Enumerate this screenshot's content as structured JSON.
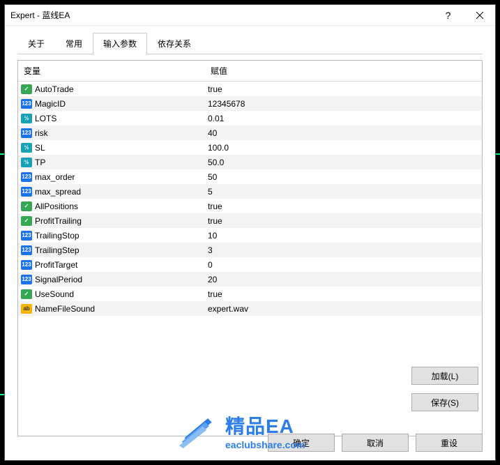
{
  "window": {
    "title": "Expert - 蓝线EA",
    "help": "?"
  },
  "tabs": {
    "about": "关于",
    "common": "常用",
    "inputs": "输入参数",
    "deps": "依存关系"
  },
  "columns": {
    "variable": "变量",
    "value": "赋值"
  },
  "params": [
    {
      "type": "bool",
      "name": "AutoTrade",
      "value": "true"
    },
    {
      "type": "int",
      "name": "MagicID",
      "value": "12345678"
    },
    {
      "type": "dbl",
      "name": "LOTS",
      "value": "0.01"
    },
    {
      "type": "int",
      "name": "risk",
      "value": "40"
    },
    {
      "type": "dbl",
      "name": "SL",
      "value": "100.0"
    },
    {
      "type": "dbl",
      "name": "TP",
      "value": "50.0"
    },
    {
      "type": "int",
      "name": "max_order",
      "value": "50"
    },
    {
      "type": "int",
      "name": "max_spread",
      "value": "5"
    },
    {
      "type": "bool",
      "name": "AllPositions",
      "value": "true"
    },
    {
      "type": "bool",
      "name": "ProfitTrailing",
      "value": "true"
    },
    {
      "type": "int",
      "name": "TrailingStop",
      "value": "10"
    },
    {
      "type": "int",
      "name": "TrailingStep",
      "value": "3"
    },
    {
      "type": "int",
      "name": "ProfitTarget",
      "value": "0"
    },
    {
      "type": "int",
      "name": "SignalPeriod",
      "value": "20"
    },
    {
      "type": "bool",
      "name": "UseSound",
      "value": "true"
    },
    {
      "type": "str",
      "name": "NameFileSound",
      "value": "expert.wav"
    }
  ],
  "buttons": {
    "load": "加载(L)",
    "save": "保存(S)",
    "ok": "确定",
    "cancel": "取消",
    "reset": "重设"
  },
  "watermark": {
    "main": "精品EA",
    "sub": "eaclubshare.com"
  },
  "iconText": {
    "bool": "✓",
    "int": "123",
    "dbl": "½",
    "str": "ab"
  }
}
